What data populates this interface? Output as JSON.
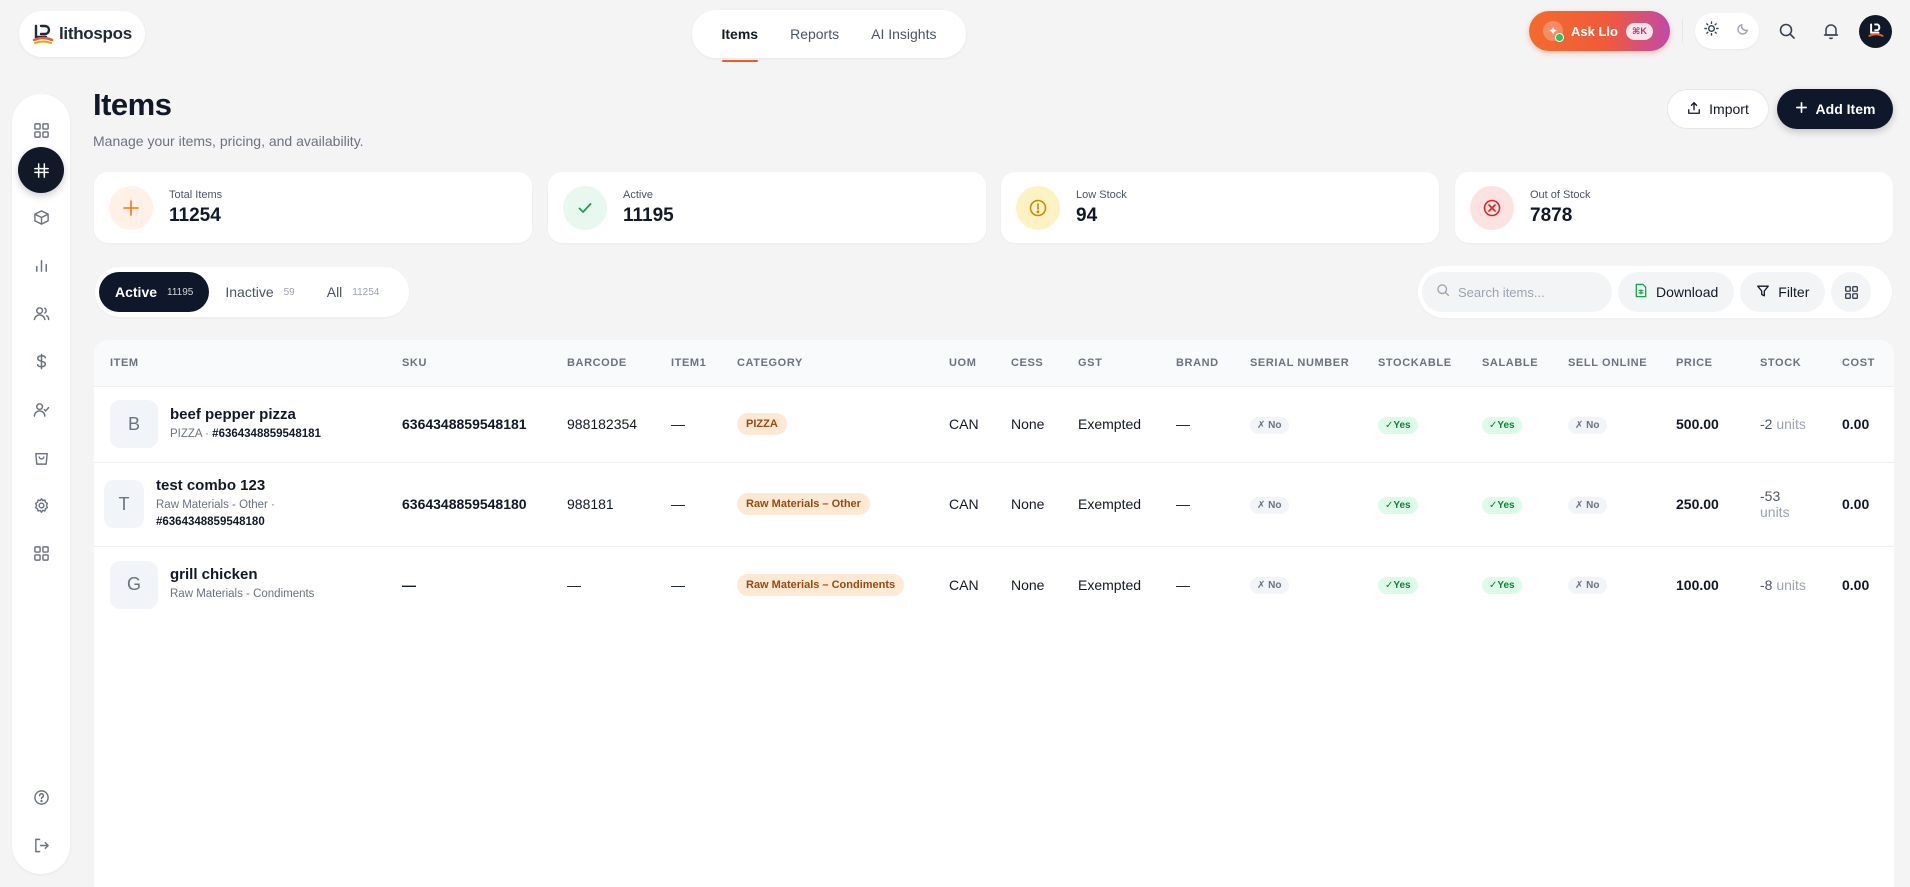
{
  "brand": {
    "name": "lithospos"
  },
  "topnav": {
    "tabs": [
      "Items",
      "Reports",
      "AI Insights"
    ],
    "active": "Items"
  },
  "topright": {
    "ask_label": "Ask Llo",
    "ask_badge": "⌘K",
    "icons": [
      "sun-icon",
      "moon-icon",
      "search-icon",
      "bell-icon",
      "avatar"
    ]
  },
  "sidebar": {
    "icons": [
      "dashboard-icon",
      "items-icon",
      "box-icon",
      "chart-icon",
      "users-icon",
      "dollar-icon",
      "user-check-icon",
      "bag-icon",
      "gear-icon",
      "apps-icon",
      "help-icon",
      "logout-icon"
    ],
    "active": "items-icon"
  },
  "header": {
    "title": "Items",
    "subtitle": "Manage your items, pricing, and availability.",
    "import_label": "Import",
    "add_label": "Add Item"
  },
  "stats": [
    {
      "label": "Total Items",
      "value": "11254",
      "color": "#f97316"
    },
    {
      "label": "Active",
      "value": "11195",
      "color": "#16a34a"
    },
    {
      "label": "Low Stock",
      "value": "94",
      "color": "#ca8a04"
    },
    {
      "label": "Out of Stock",
      "value": "7878",
      "color": "#dc2626"
    }
  ],
  "filters": {
    "tabs": [
      {
        "label": "Active",
        "count": "11195"
      },
      {
        "label": "Inactive",
        "count": "59"
      },
      {
        "label": "All",
        "count": "11254"
      }
    ],
    "active": "Active",
    "search_placeholder": "Search items...",
    "download_label": "Download",
    "filter_label": "Filter"
  },
  "table": {
    "columns": [
      "ITEM",
      "SKU",
      "BARCODE",
      "ITEM1",
      "CATEGORY",
      "UOM",
      "CESS",
      "GST",
      "BRAND",
      "SERIAL NUMBER",
      "STOCKABLE",
      "SALABLE",
      "SELL ONLINE",
      "PRICE",
      "STOCK",
      "COST"
    ],
    "rows": [
      {
        "initial": "B",
        "name": "beef pepper pizza",
        "meta": "PIZZA · ",
        "meta_code": "#6364348859548181",
        "sku": "6364348859548181",
        "barcode": "988182354",
        "item1": "—",
        "category": "PIZZA",
        "uom": "CAN",
        "cess": "None",
        "gst": "Exempted",
        "brand": "—",
        "serial": "✗ No",
        "stockable": "✓Yes",
        "salable": "✓Yes",
        "sell_online": "✗ No",
        "price": "500.00",
        "stock": "-2",
        "stock_unit": "units",
        "cost": "0.00"
      },
      {
        "initial": "T",
        "name": "test combo 123",
        "meta": "Raw Materials - Other ·",
        "meta_code": "#6364348859548180",
        "sku": "6364348859548180",
        "barcode": "988181",
        "item1": "—",
        "category": "Raw Materials – Other",
        "uom": "CAN",
        "cess": "None",
        "gst": "Exempted",
        "brand": "—",
        "serial": "✗ No",
        "stockable": "✓Yes",
        "salable": "✓Yes",
        "sell_online": "✗ No",
        "price": "250.00",
        "stock": "-53",
        "stock_unit": "units",
        "cost": "0.00"
      },
      {
        "initial": "G",
        "name": "grill chicken",
        "meta": "Raw Materials - Condiments",
        "meta_code": "",
        "sku": "—",
        "barcode": "—",
        "item1": "—",
        "category": "Raw Materials – Condiments",
        "uom": "CAN",
        "cess": "None",
        "gst": "Exempted",
        "brand": "—",
        "serial": "✗ No",
        "stockable": "✓Yes",
        "salable": "✓Yes",
        "sell_online": "✗ No",
        "price": "100.00",
        "stock": "-8",
        "stock_unit": "units",
        "cost": "0.00"
      }
    ]
  }
}
